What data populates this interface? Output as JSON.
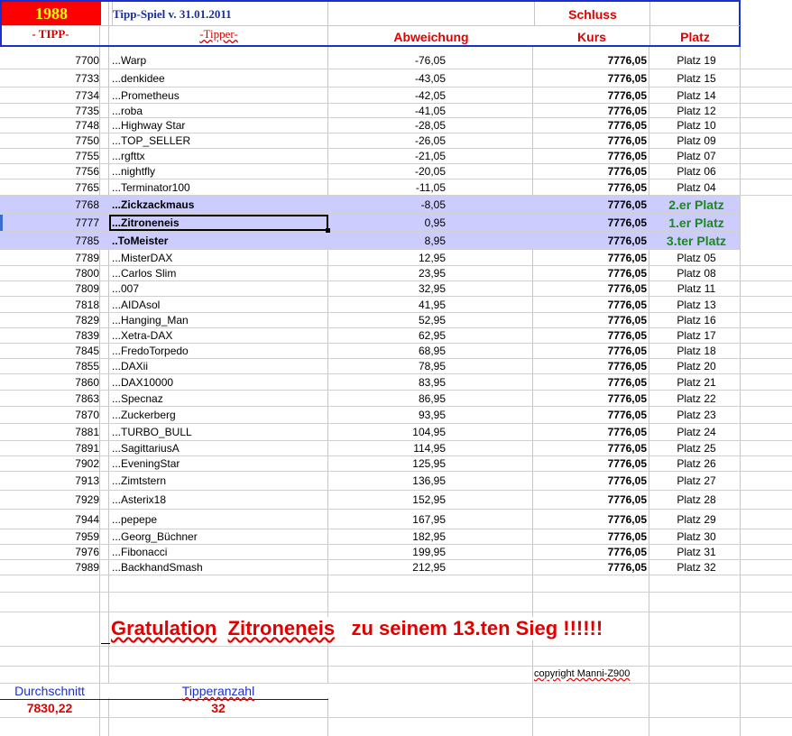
{
  "header": {
    "year": "1988",
    "title": "Tipp-Spiel v. 31.01.2011",
    "schluss": "Schluss",
    "col_tipp": "- TIPP-",
    "col_tipper": "-Tipper-",
    "col_abweichung": "Abweichung",
    "col_kurs": "Kurs",
    "col_platz": "Platz"
  },
  "rows": [
    {
      "tipp": "7700",
      "name": "...Warp",
      "abw": "-76,05",
      "kurs": "7776,05",
      "platz": "Platz 19"
    },
    {
      "tipp": "7733",
      "name": "...denkidee",
      "abw": "-43,05",
      "kurs": "7776,05",
      "platz": "Platz 15"
    },
    {
      "tipp": "7734",
      "name": "...Prometheus",
      "abw": "-42,05",
      "kurs": "7776,05",
      "platz": "Platz 14"
    },
    {
      "tipp": "7735",
      "name": "...roba",
      "abw": "-41,05",
      "kurs": "7776,05",
      "platz": "Platz 12"
    },
    {
      "tipp": "7748",
      "name": "...Highway Star",
      "abw": "-28,05",
      "kurs": "7776,05",
      "platz": "Platz 10"
    },
    {
      "tipp": "7750",
      "name": "...TOP_SELLER",
      "abw": "-26,05",
      "kurs": "7776,05",
      "platz": "Platz 09"
    },
    {
      "tipp": "7755",
      "name": "...rgfttx",
      "abw": "-21,05",
      "kurs": "7776,05",
      "platz": "Platz 07"
    },
    {
      "tipp": "7756",
      "name": "...nightfly",
      "abw": "-20,05",
      "kurs": "7776,05",
      "platz": "Platz 06"
    },
    {
      "tipp": "7765",
      "name": "...Terminator100",
      "abw": "-11,05",
      "kurs": "7776,05",
      "platz": "Platz 04"
    },
    {
      "tipp": "7768",
      "name": "...Zickzackmaus",
      "abw": "-8,05",
      "kurs": "7776,05",
      "platz": "2.er Platz"
    },
    {
      "tipp": "7777",
      "name": "...Zitroneneis",
      "abw": "0,95",
      "kurs": "7776,05",
      "platz": "1.er Platz"
    },
    {
      "tipp": "7785",
      "name": "..ToMeister",
      "abw": "8,95",
      "kurs": "7776,05",
      "platz": "3.ter Platz"
    },
    {
      "tipp": "7789",
      "name": "...MisterDAX",
      "abw": "12,95",
      "kurs": "7776,05",
      "platz": "Platz 05"
    },
    {
      "tipp": "7800",
      "name": "...Carlos Slim",
      "abw": "23,95",
      "kurs": "7776,05",
      "platz": "Platz 08"
    },
    {
      "tipp": "7809",
      "name": "...007",
      "abw": "32,95",
      "kurs": "7776,05",
      "platz": "Platz 11"
    },
    {
      "tipp": "7818",
      "name": "...AIDAsol",
      "abw": "41,95",
      "kurs": "7776,05",
      "platz": "Platz 13"
    },
    {
      "tipp": "7829",
      "name": "...Hanging_Man",
      "abw": "52,95",
      "kurs": "7776,05",
      "platz": "Platz 16"
    },
    {
      "tipp": "7839",
      "name": "...Xetra-DAX",
      "abw": "62,95",
      "kurs": "7776,05",
      "platz": "Platz 17"
    },
    {
      "tipp": "7845",
      "name": "...FredoTorpedo",
      "abw": "68,95",
      "kurs": "7776,05",
      "platz": "Platz 18"
    },
    {
      "tipp": "7855",
      "name": "...DAXii",
      "abw": "78,95",
      "kurs": "7776,05",
      "platz": "Platz 20"
    },
    {
      "tipp": "7860",
      "name": "...DAX10000",
      "abw": "83,95",
      "kurs": "7776,05",
      "platz": "Platz 21"
    },
    {
      "tipp": "7863",
      "name": "...Specnaz",
      "abw": "86,95",
      "kurs": "7776,05",
      "platz": "Platz 22"
    },
    {
      "tipp": "7870",
      "name": "...Zuckerberg",
      "abw": "93,95",
      "kurs": "7776,05",
      "platz": "Platz 23"
    },
    {
      "tipp": "7881",
      "name": "...TURBO_BULL",
      "abw": "104,95",
      "kurs": "7776,05",
      "platz": "Platz 24"
    },
    {
      "tipp": "7891",
      "name": "...SagittariusA",
      "abw": "114,95",
      "kurs": "7776,05",
      "platz": "Platz 25"
    },
    {
      "tipp": "7902",
      "name": "...EveningStar",
      "abw": "125,95",
      "kurs": "7776,05",
      "platz": "Platz 26"
    },
    {
      "tipp": "7913",
      "name": "...Zimtstern",
      "abw": "136,95",
      "kurs": "7776,05",
      "platz": "Platz 27"
    },
    {
      "tipp": "7929",
      "name": "...Asterix18",
      "abw": "152,95",
      "kurs": "7776,05",
      "platz": "Platz 28"
    },
    {
      "tipp": "7944",
      "name": "...pepepe",
      "abw": "167,95",
      "kurs": "7776,05",
      "platz": "Platz 29"
    },
    {
      "tipp": "7959",
      "name": "...Georg_Büchner",
      "abw": "182,95",
      "kurs": "7776,05",
      "platz": "Platz 30"
    },
    {
      "tipp": "7976",
      "name": "...Fibonacci",
      "abw": "199,95",
      "kurs": "7776,05",
      "platz": "Platz 31"
    },
    {
      "tipp": "7989",
      "name": "...BackhandSmash",
      "abw": "212,95",
      "kurs": "7776,05",
      "platz": "Platz 32"
    }
  ],
  "highlight_color": "#ccccff",
  "congrats": {
    "part1": "Gratulation",
    "part2": "Zitroneneis",
    "part3": "zu seinem 13.ten Sieg !!!!!!"
  },
  "copyright": "copyright Manni-Z900",
  "footer": {
    "durchschnitt_label": "Durchschnitt",
    "durchschnitt_value": "7830,22",
    "tipperanzahl_label": "Tipperanzahl",
    "tipperanzahl_value": "32"
  }
}
